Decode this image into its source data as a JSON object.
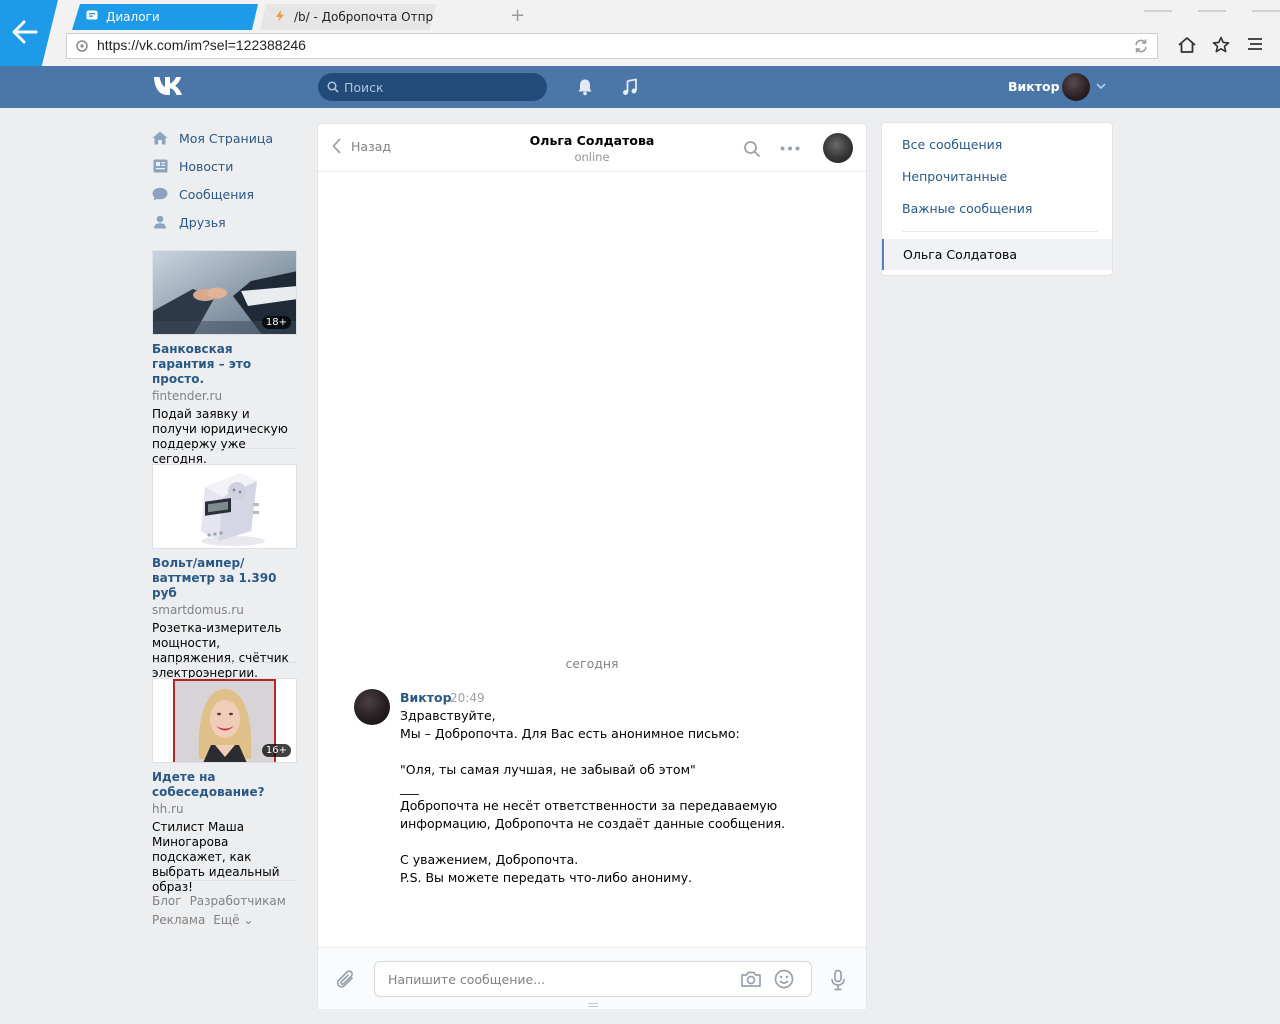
{
  "browser": {
    "tabs": [
      {
        "title": "Диалоги",
        "active": true
      },
      {
        "title": "/b/ - Добропочта Отпра…",
        "active": false
      }
    ],
    "new_tab_label": "+",
    "url": "https://vk.com/im?sel=122388246"
  },
  "header": {
    "search_placeholder": "Поиск",
    "user_name": "Виктор"
  },
  "left_nav": {
    "items": [
      {
        "label": "Моя Страница",
        "icon": "home-icon"
      },
      {
        "label": "Новости",
        "icon": "news-icon"
      },
      {
        "label": "Сообщения",
        "icon": "messages-icon"
      },
      {
        "label": "Друзья",
        "icon": "friends-icon"
      }
    ]
  },
  "ads": [
    {
      "title": "Банковская гарантия – это просто.",
      "domain": "fintender.ru",
      "desc": "Подай заявку и получи юридическую поддержу уже сегодня.",
      "badge": "18+"
    },
    {
      "title": "Вольт/ампер/ваттметр за 1.390 руб",
      "domain": "smartdomus.ru",
      "desc": "Розетка-измеритель мощности, напряжения, счётчик электроэнергии.",
      "badge": ""
    },
    {
      "title": "Идете на собеседование?",
      "domain": "hh.ru",
      "desc": "Стилист Маша Миногарова подскажет, как выбрать идеальный образ!",
      "badge": "16+"
    }
  ],
  "footer": {
    "links": [
      "Блог",
      "Разработчикам",
      "Реклама",
      "Ещё ⌄"
    ]
  },
  "chat": {
    "back_label": "Назад",
    "contact_name": "Ольга Солдатова",
    "contact_status": "online",
    "date_separator": "сегодня",
    "message": {
      "author": "Виктор",
      "time": "20:49",
      "lines": [
        "Здравствуйте,",
        "Мы – Добропочта. Для Вас есть анонимное письмо:",
        "",
        "\"Оля, ты самая лучшая, не забывай об этом\"",
        "___",
        "Добропочта не несёт ответственности за передаваемую",
        "информацию, Добропочта не создаёт данные сообщения.",
        "",
        "С уважением, Добропочта.",
        "P.S. Вы можете передать что-либо анониму."
      ]
    },
    "input_placeholder": "Напишите сообщение..."
  },
  "right_menu": {
    "items": [
      "Все сообщения",
      "Непрочитанные",
      "Важные сообщения"
    ],
    "selected_dialog": "Ольга Солдатова"
  },
  "colors": {
    "vk_blue": "#4a76a8",
    "link": "#2a5885",
    "browser_accent": "#1e9be8"
  }
}
